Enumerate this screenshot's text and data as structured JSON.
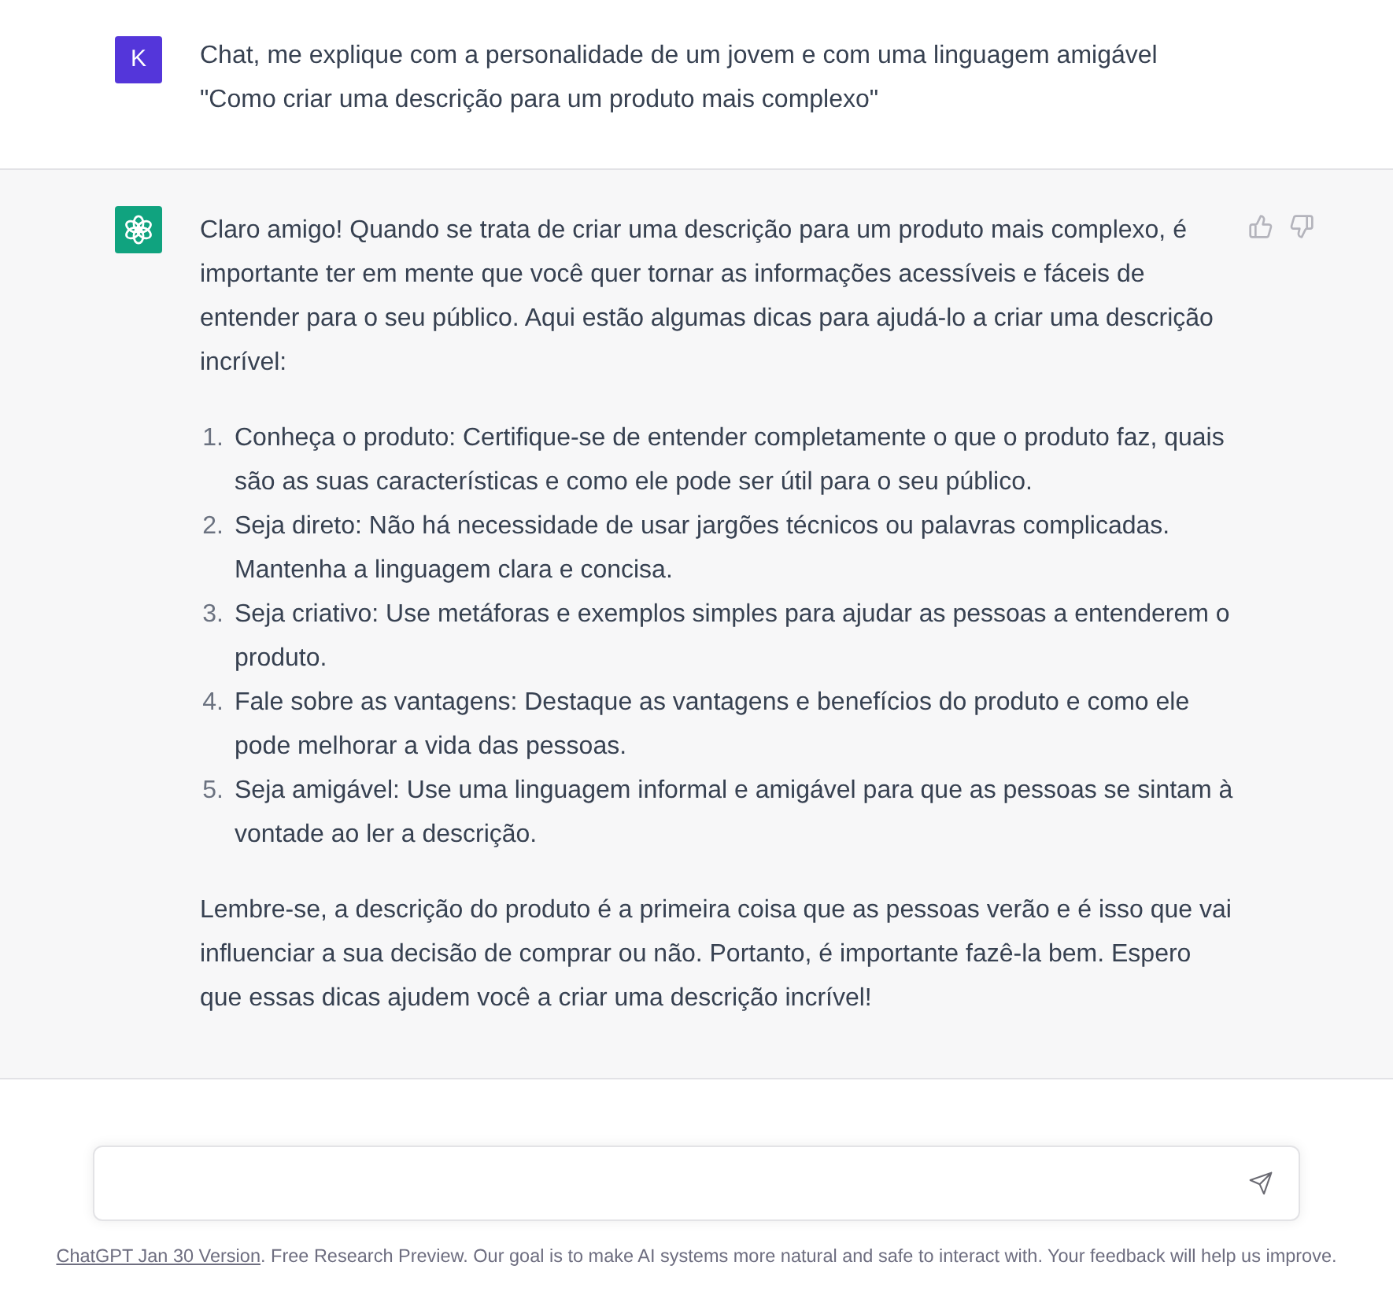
{
  "conversation": [
    {
      "kind": "user",
      "avatar": "K",
      "blocks": [
        {
          "kind": "paragraph",
          "text": "Chat, me explique com a personalidade de um jovem e com uma linguagem amigável\n\"Como criar uma descrição para um produto mais complexo\""
        }
      ]
    },
    {
      "kind": "assistant",
      "blocks": [
        {
          "kind": "paragraph",
          "text": "Claro amigo! Quando se trata de criar uma descrição para um produto mais complexo, é importante ter em mente que você quer tornar as informações acessíveis e fáceis de entender para o seu público. Aqui estão algumas dicas para ajudá-lo a criar uma descrição incrível:"
        },
        {
          "kind": "list",
          "items": [
            {
              "number": "1.",
              "text": "Conheça o produto: Certifique-se de entender completamente o que o produto faz, quais são as suas características e como ele pode ser útil para o seu público."
            },
            {
              "number": "2.",
              "text": "Seja direto: Não há necessidade de usar jargões técnicos ou palavras complicadas. Mantenha a linguagem clara e concisa."
            },
            {
              "number": "3.",
              "text": "Seja criativo: Use metáforas e exemplos simples para ajudar as pessoas a entenderem o produto."
            },
            {
              "number": "4.",
              "text": "Fale sobre as vantagens: Destaque as vantagens e benefícios do produto e como ele pode melhorar a vida das pessoas."
            },
            {
              "number": "5.",
              "text": "Seja amigável: Use uma linguagem informal e amigável para que as pessoas se sintam à vontade ao ler a descrição."
            }
          ]
        },
        {
          "kind": "paragraph",
          "text": "Lembre-se, a descrição do produto é a primeira coisa que as pessoas verão e é isso que vai influenciar a sua decisão de comprar ou não. Portanto, é importante fazê-la bem. Espero que essas dicas ajudem você a criar uma descrição incrível!"
        }
      ]
    }
  ],
  "footer": {
    "link": "ChatGPT Jan 30 Version",
    "text": ". Free Research Preview. Our goal is to make AI systems more natural and safe to interact with. Your feedback will help us improve."
  }
}
